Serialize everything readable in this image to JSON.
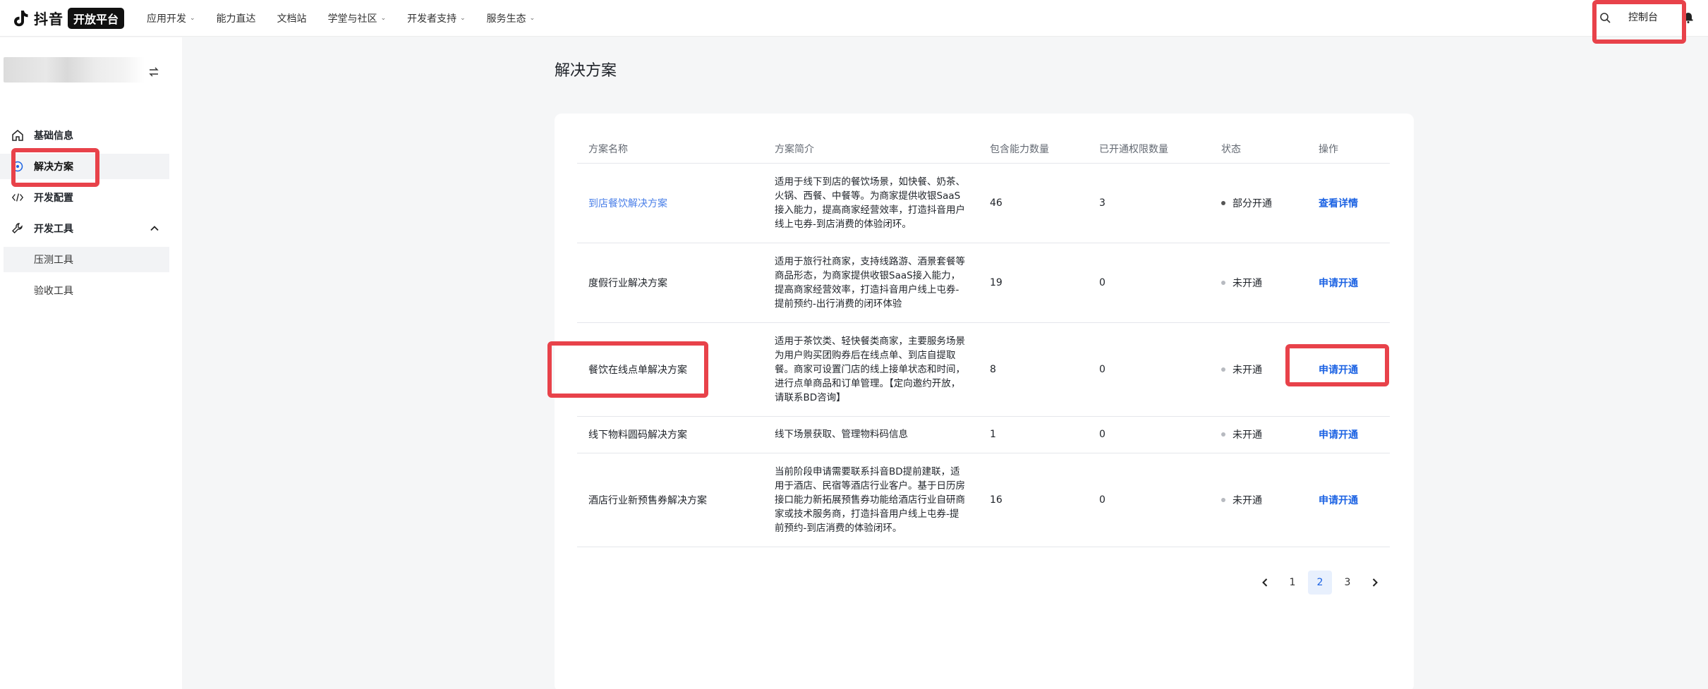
{
  "brand": {
    "name": "抖音",
    "badge": "开放平台"
  },
  "nav": [
    {
      "label": "应用开发",
      "has_menu": true
    },
    {
      "label": "能力直达",
      "has_menu": false
    },
    {
      "label": "文档站",
      "has_menu": false
    },
    {
      "label": "学堂与社区",
      "has_menu": true
    },
    {
      "label": "开发者支持",
      "has_menu": true
    },
    {
      "label": "服务生态",
      "has_menu": true
    }
  ],
  "header": {
    "console_label": "控制台",
    "search_icon": "search-icon",
    "bell_icon": "bell-icon"
  },
  "sidebar": {
    "items": [
      {
        "label": "基础信息",
        "icon": "home-icon"
      },
      {
        "label": "解决方案",
        "icon": "solution-icon",
        "active": true
      },
      {
        "label": "开发配置",
        "icon": "code-icon"
      },
      {
        "label": "开发工具",
        "icon": "wrench-icon",
        "expanded": true
      }
    ],
    "sub_items": [
      {
        "label": "压测工具",
        "active": true
      },
      {
        "label": "验收工具"
      }
    ]
  },
  "main": {
    "title": "解决方案",
    "table": {
      "columns": [
        "方案名称",
        "方案简介",
        "包含能力数量",
        "已开通权限数量",
        "状态",
        "操作"
      ],
      "rows": [
        {
          "name": "到店餐饮解决方案",
          "name_is_link": true,
          "desc": "适用于线下到店的餐饮场景，如快餐、奶茶、火锅、西餐、中餐等。为商家提供收银SaaS 接入能力，提高商家经营效率，打造抖音用户线上屯券-到店消费的体验闭环。",
          "capabilities": "46",
          "granted": "3",
          "status": "部分开通",
          "status_on": true,
          "action": "查看详情"
        },
        {
          "name": "度假行业解决方案",
          "name_is_link": false,
          "desc": "适用于旅行社商家，支持线路游、酒景套餐等商品形态，为商家提供收银SaaS接入能力，提高商家经营效率，打造抖音用户线上屯券-提前预约-出行消费的闭环体验",
          "capabilities": "19",
          "granted": "0",
          "status": "未开通",
          "status_on": false,
          "action": "申请开通"
        },
        {
          "name": "餐饮在线点单解决方案",
          "name_is_link": false,
          "desc": "适用于茶饮类、轻快餐类商家，主要服务场景为用户购买团购券后在线点单、到店自提取餐。商家可设置门店的线上接单状态和时间，进行点单商品和订单管理。【定向邀约开放，请联系BD咨询】",
          "capabilities": "8",
          "granted": "0",
          "status": "未开通",
          "status_on": false,
          "action": "申请开通"
        },
        {
          "name": "线下物料圆码解决方案",
          "name_is_link": false,
          "desc": "线下场景获取、管理物料码信息",
          "capabilities": "1",
          "granted": "0",
          "status": "未开通",
          "status_on": false,
          "action": "申请开通"
        },
        {
          "name": "酒店行业新预售券解决方案",
          "name_is_link": false,
          "desc": "当前阶段申请需要联系抖音BD提前建联，适用于酒店、民宿等酒店行业客户。基于日历房接口能力新拓展预售券功能给酒店行业自研商家或技术服务商，打造抖音用户线上屯券-提前预约-到店消费的体验闭环。",
          "capabilities": "16",
          "granted": "0",
          "status": "未开通",
          "status_on": false,
          "action": "申请开通"
        }
      ]
    },
    "pagination": {
      "pages": [
        "1",
        "2",
        "3"
      ],
      "current": "2"
    }
  },
  "colors": {
    "accent": "#1b62e3",
    "link": "#4a7fe8",
    "highlight": "#e8424a"
  }
}
